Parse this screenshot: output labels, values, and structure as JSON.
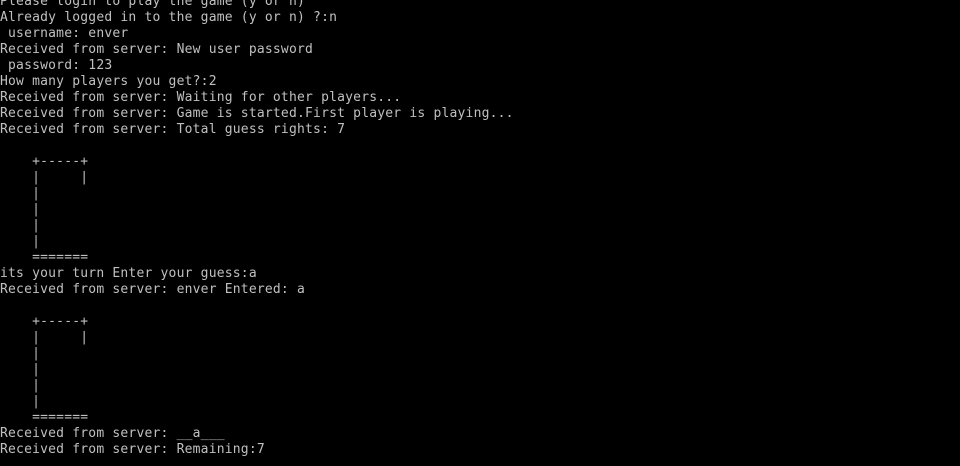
{
  "window": {
    "background": "#000000",
    "text_color": "#c0c0c0"
  },
  "lines": [
    "Please login to play the game (y or n)",
    "Already logged in to the game (y or n) ?:n",
    " username: enver",
    "Received from server: New user password",
    " password: 123",
    "How many players you get?:2",
    "Received from server: Waiting for other players...",
    "Received from server: Game is started.First player is playing...",
    "Received from server: Total guess rights: 7",
    "",
    "    +-----+",
    "    |     |",
    "    |",
    "    |",
    "    |",
    "    |",
    "    =======",
    "its your turn Enter your guess:a",
    "Received from server: enver Entered: a",
    "",
    "    +-----+",
    "    |     |",
    "    |",
    "    |",
    "    |",
    "    |",
    "    =======",
    "Received from server: __a___",
    "Received from server: Remaining:7"
  ]
}
